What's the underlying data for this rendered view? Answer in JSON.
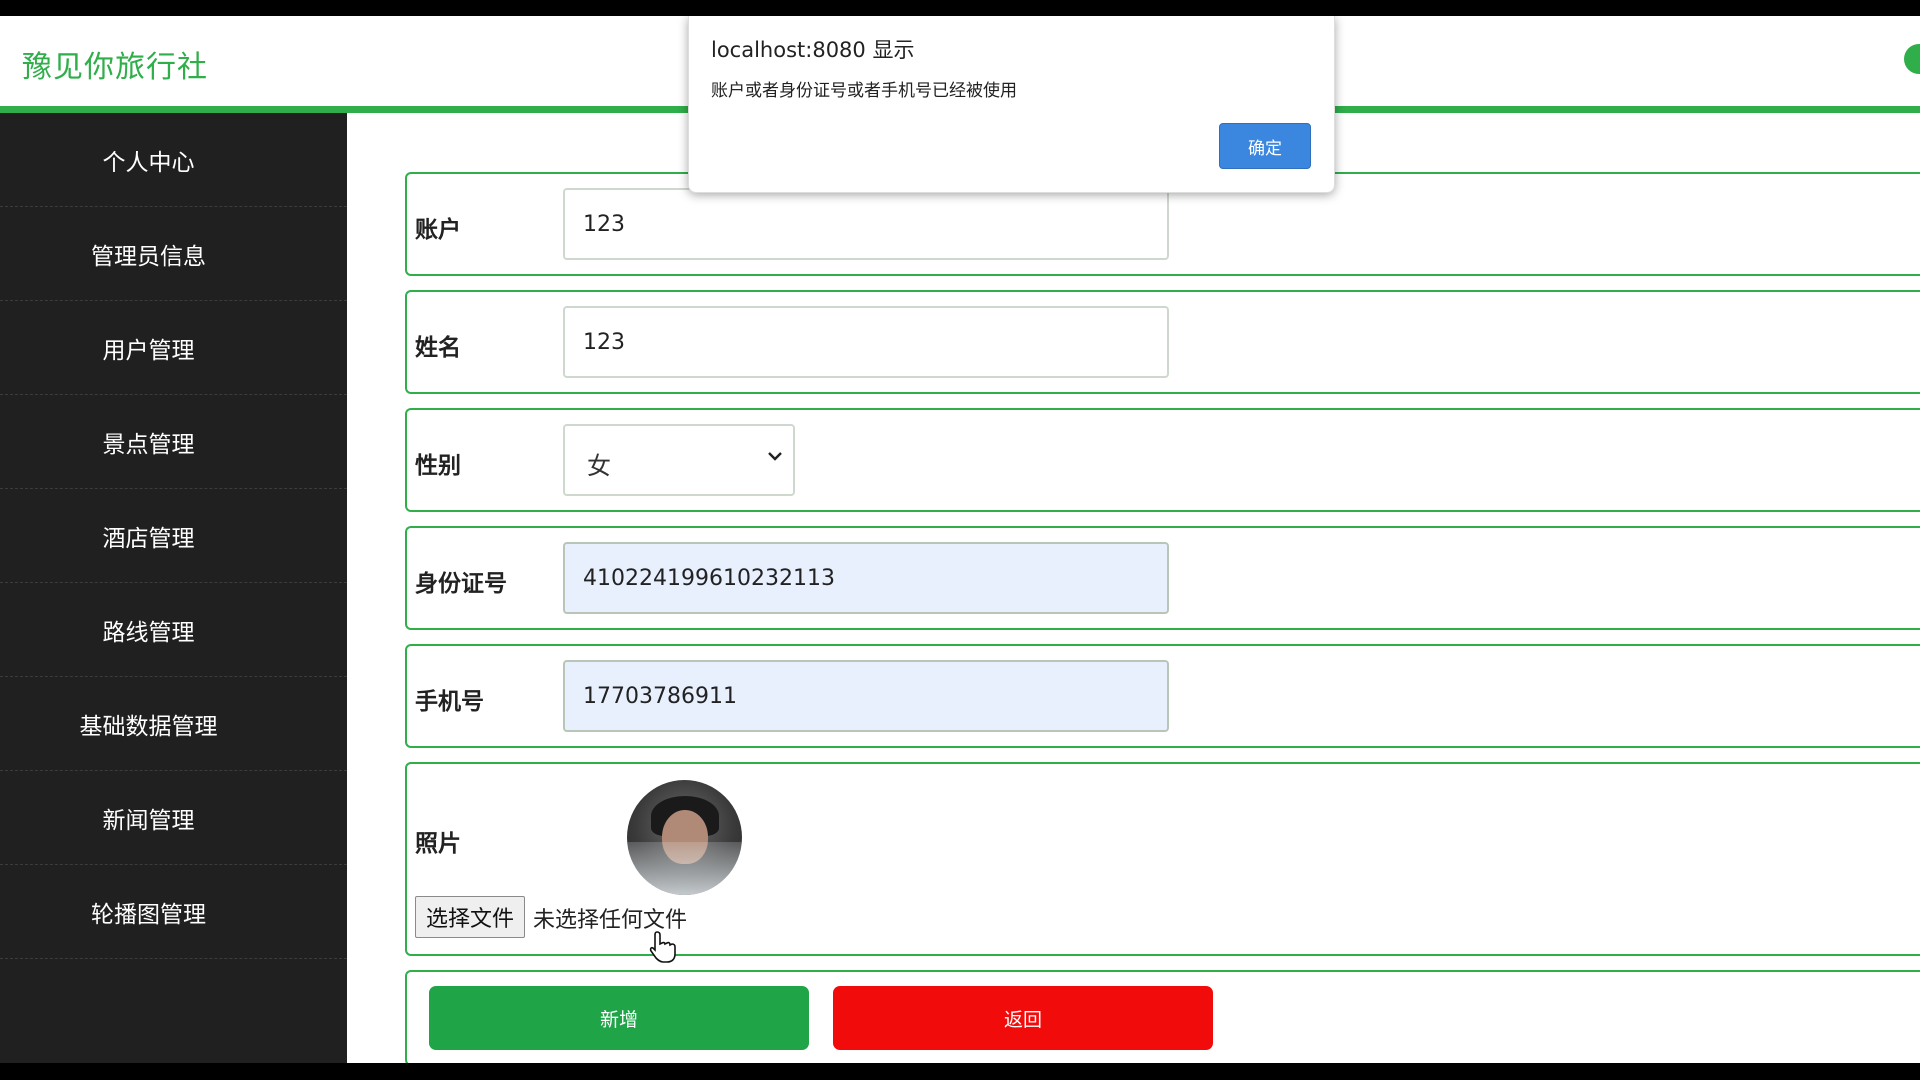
{
  "header": {
    "brand": "豫见你旅行社"
  },
  "sidebar": {
    "items": [
      {
        "label": "个人中心"
      },
      {
        "label": "管理员信息"
      },
      {
        "label": "用户管理"
      },
      {
        "label": "景点管理"
      },
      {
        "label": "酒店管理"
      },
      {
        "label": "路线管理"
      },
      {
        "label": "基础数据管理"
      },
      {
        "label": "新闻管理"
      },
      {
        "label": "轮播图管理"
      }
    ]
  },
  "form": {
    "account": {
      "label": "账户",
      "value": "123"
    },
    "name": {
      "label": "姓名",
      "value": "123"
    },
    "gender": {
      "label": "性别",
      "value": "女"
    },
    "id_number": {
      "label": "身份证号",
      "value": "410224199610232113"
    },
    "phone": {
      "label": "手机号",
      "value": "17703786911"
    },
    "photo": {
      "label": "照片",
      "file_button": "选择文件",
      "file_status": "未选择任何文件"
    },
    "buttons": {
      "add": "新增",
      "back": "返回"
    }
  },
  "dialog": {
    "title": "localhost:8080 显示",
    "message": "账户或者身份证号或者手机号已经被使用",
    "ok": "确定"
  },
  "colors": {
    "brand_green": "#2fae4a",
    "sidebar_bg": "#1f201f",
    "add_button": "#1fa447",
    "back_button": "#f10b0b",
    "dialog_button": "#3b87e0"
  }
}
